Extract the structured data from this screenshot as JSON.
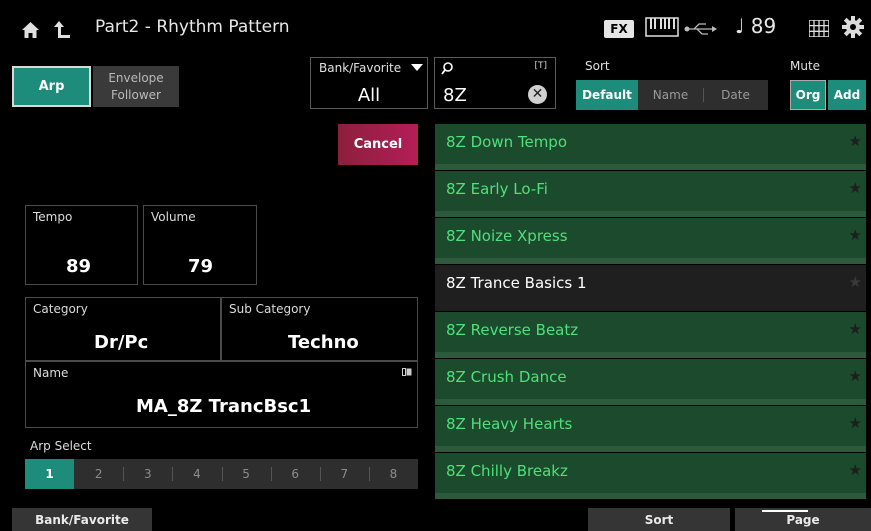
{
  "header": {
    "title": "Part2 - Rhythm Pattern",
    "fx_badge": "FX",
    "tempo_readout": "♩ 89"
  },
  "mode_buttons": {
    "arp": "Arp",
    "envelope_follower": "Envelope\nFollower"
  },
  "bank": {
    "label": "Bank/Favorite",
    "value": "All"
  },
  "search": {
    "value": "8Z",
    "text_flag": "[T]",
    "clear": "✕"
  },
  "sort": {
    "label": "Sort",
    "options": [
      "Default",
      "Name",
      "Date"
    ],
    "selected": "Default"
  },
  "mute": {
    "label": "Mute",
    "org": "Org",
    "add": "Add"
  },
  "cancel_label": "Cancel",
  "params": {
    "tempo": {
      "label": "Tempo",
      "value": "89"
    },
    "volume": {
      "label": "Volume",
      "value": "79"
    },
    "category": {
      "label": "Category",
      "value": "Dr/Pc"
    },
    "sub_category": {
      "label": "Sub Category",
      "value": "Techno"
    },
    "name": {
      "label": "Name",
      "value": "MA_8Z TrancBsc1"
    }
  },
  "arp_select": {
    "label": "Arp Select",
    "options": [
      "1",
      "2",
      "3",
      "4",
      "5",
      "6",
      "7",
      "8"
    ],
    "selected": "1"
  },
  "results": [
    {
      "name": "8Z Down Tempo",
      "star": "★"
    },
    {
      "name": "8Z Early Lo-Fi",
      "star": "★"
    },
    {
      "name": "8Z Noize Xpress",
      "star": "★"
    },
    {
      "name": "8Z Trance Basics 1",
      "star": "★"
    },
    {
      "name": "8Z Reverse Beatz",
      "star": "★"
    },
    {
      "name": "8Z Crush Dance",
      "star": "★"
    },
    {
      "name": "8Z Heavy Hearts",
      "star": "★"
    },
    {
      "name": "8Z Chilly Breakz",
      "star": "★"
    }
  ],
  "selected_result": "8Z Trance Basics 1",
  "bottom_tabs": {
    "bank_favorite": "Bank/Favorite",
    "sort": "Sort",
    "page": "Page"
  },
  "colors": {
    "accent": "#1d8c7a",
    "list_text": "#4fe07a",
    "cancel": "#b41e57"
  }
}
